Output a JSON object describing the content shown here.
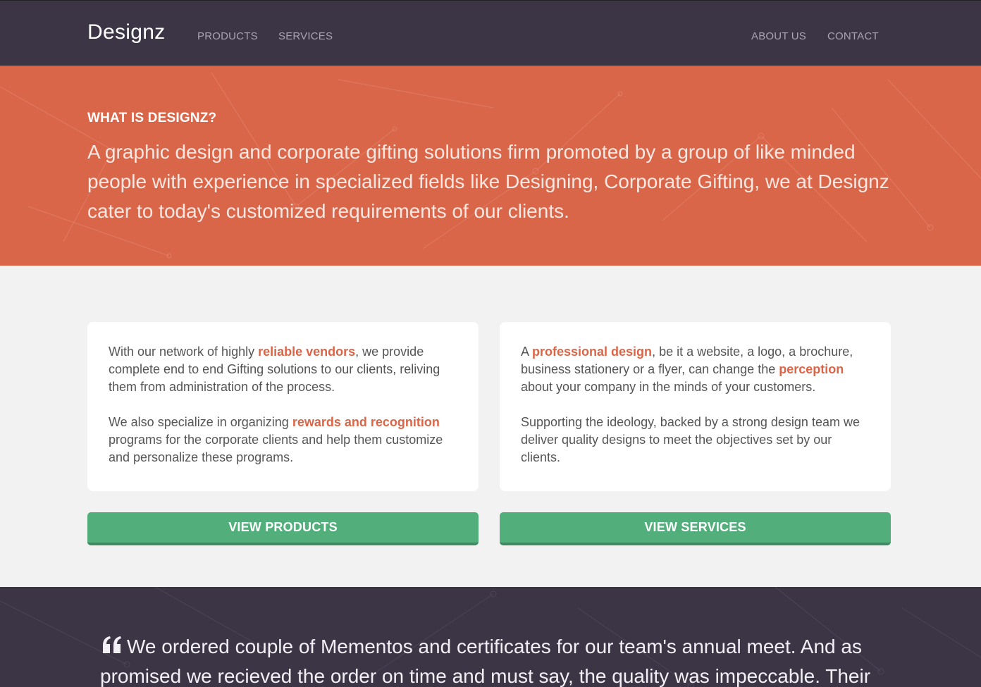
{
  "nav": {
    "brand": "Designz",
    "left_links": [
      "PRODUCTS",
      "SERVICES"
    ],
    "right_links": [
      "ABOUT US",
      "CONTACT"
    ]
  },
  "hero": {
    "heading": "WHAT IS DESIGNZ?",
    "text": "A graphic design and corporate gifting solutions firm promoted by a group of like minded people with experience in specialized fields like Designing, Corporate Gifting, we at Designz cater to today's customized requirements of our clients."
  },
  "cards": {
    "left": {
      "p1_before": "With our network of highly ",
      "p1_highlight": "reliable vendors",
      "p1_after": ", we provide complete end to end Gifting solutions to our clients, reliving them from administration of the process.",
      "p2_before": "We also specialize in organizing ",
      "p2_highlight": "rewards and recognition",
      "p2_after": " programs for the corporate clients and help them customize and personalize these programs."
    },
    "right": {
      "p1_before": "A ",
      "p1_highlight": "professional design",
      "p1_middle": ", be it a website, a logo, a brochure, business stationery or a flyer, can change the ",
      "p1_highlight2": "perception",
      "p1_after": " about your company in the minds of your customers.",
      "p2": "Supporting the ideology, backed by a strong design team we deliver quality designs to meet the objectives set by our clients."
    }
  },
  "buttons": {
    "products": "VIEW PRODUCTS",
    "services": "VIEW SERVICES"
  },
  "testimonial": {
    "icon": "quote-icon",
    "text": "We ordered couple of Mementos and certificates for our team's annual meet. And as promised we recieved the order on time and must say, the quality was impeccable. Their"
  },
  "colors": {
    "navbar": "#3c3546",
    "hero": "#da664a",
    "highlight": "#dd6547",
    "button": "#52ae7a"
  }
}
